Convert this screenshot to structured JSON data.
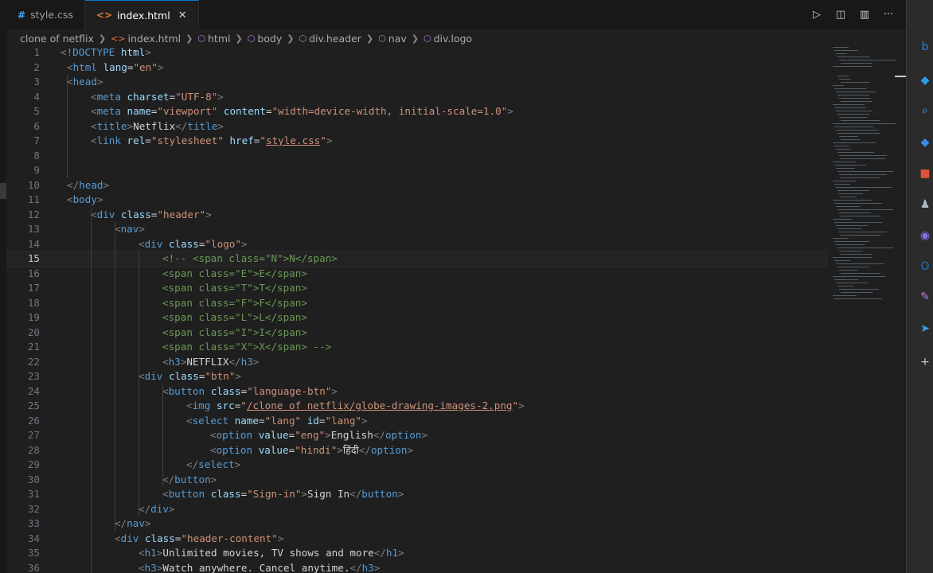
{
  "tabs": [
    {
      "label": "style.css",
      "icon": "css-file-icon",
      "active": false
    },
    {
      "label": "index.html",
      "icon": "html-file-icon",
      "active": true
    }
  ],
  "tab_actions": [
    "run-icon",
    "compare-icon",
    "split-editor-icon",
    "more-icon"
  ],
  "breadcrumb": [
    {
      "label": "clone of netflix",
      "icon": ""
    },
    {
      "label": "index.html",
      "icon": "html-file-icon"
    },
    {
      "label": "html",
      "icon": "cube-icon"
    },
    {
      "label": "body",
      "icon": "cube-icon"
    },
    {
      "label": "div.header",
      "icon": "cube-icon"
    },
    {
      "label": "nav",
      "icon": "cube-icon"
    },
    {
      "label": "div.logo",
      "icon": "cube-icon"
    }
  ],
  "current_line": 15,
  "lines": [
    {
      "n": "1",
      "indent": 0,
      "tokens": [
        [
          "punc",
          "<!"
        ],
        [
          "tag",
          "DOCTYPE"
        ],
        [
          "text",
          " "
        ],
        [
          "attr",
          "html"
        ],
        [
          "punc",
          ">"
        ]
      ]
    },
    {
      "n": "2",
      "indent": 1,
      "tokens": [
        [
          "punc",
          "<"
        ],
        [
          "tag",
          "html"
        ],
        [
          "text",
          " "
        ],
        [
          "attr",
          "lang"
        ],
        [
          "text",
          "="
        ],
        [
          "str",
          "\"en\""
        ],
        [
          "punc",
          ">"
        ]
      ]
    },
    {
      "n": "3",
      "indent": 1,
      "tokens": [
        [
          "punc",
          "<"
        ],
        [
          "tag",
          "head"
        ],
        [
          "punc",
          ">"
        ]
      ]
    },
    {
      "n": "4",
      "indent": 2,
      "tokens": [
        [
          "punc",
          "<"
        ],
        [
          "tag",
          "meta"
        ],
        [
          "text",
          " "
        ],
        [
          "attr",
          "charset"
        ],
        [
          "text",
          "="
        ],
        [
          "str",
          "\"UTF-8\""
        ],
        [
          "punc",
          ">"
        ]
      ]
    },
    {
      "n": "5",
      "indent": 2,
      "tokens": [
        [
          "punc",
          "<"
        ],
        [
          "tag",
          "meta"
        ],
        [
          "text",
          " "
        ],
        [
          "attr",
          "name"
        ],
        [
          "text",
          "="
        ],
        [
          "str",
          "\"viewport\""
        ],
        [
          "text",
          " "
        ],
        [
          "attr",
          "content"
        ],
        [
          "text",
          "="
        ],
        [
          "str",
          "\"width=device-width, initial-scale=1.0\""
        ],
        [
          "punc",
          ">"
        ]
      ]
    },
    {
      "n": "6",
      "indent": 2,
      "tokens": [
        [
          "punc",
          "<"
        ],
        [
          "tag",
          "title"
        ],
        [
          "punc",
          ">"
        ],
        [
          "text",
          "Netflix"
        ],
        [
          "punc",
          "</"
        ],
        [
          "tag",
          "title"
        ],
        [
          "punc",
          ">"
        ]
      ]
    },
    {
      "n": "7",
      "indent": 2,
      "tokens": [
        [
          "punc",
          "<"
        ],
        [
          "tag",
          "link"
        ],
        [
          "text",
          " "
        ],
        [
          "attr",
          "rel"
        ],
        [
          "text",
          "="
        ],
        [
          "str",
          "\"stylesheet\""
        ],
        [
          "text",
          " "
        ],
        [
          "attr",
          "href"
        ],
        [
          "text",
          "="
        ],
        [
          "str",
          "\""
        ],
        [
          "ul",
          "style.css"
        ],
        [
          "str",
          "\""
        ],
        [
          "punc",
          ">"
        ]
      ]
    },
    {
      "n": "8",
      "indent": 0,
      "tokens": []
    },
    {
      "n": "9",
      "indent": 0,
      "tokens": []
    },
    {
      "n": "10",
      "indent": 1,
      "tokens": [
        [
          "punc",
          "</"
        ],
        [
          "tag",
          "head"
        ],
        [
          "punc",
          ">"
        ]
      ]
    },
    {
      "n": "11",
      "indent": 1,
      "tokens": [
        [
          "punc",
          "<"
        ],
        [
          "tag",
          "body"
        ],
        [
          "punc",
          ">"
        ]
      ]
    },
    {
      "n": "12",
      "indent": 2,
      "tokens": [
        [
          "punc",
          "<"
        ],
        [
          "tag",
          "div"
        ],
        [
          "text",
          " "
        ],
        [
          "attr",
          "class"
        ],
        [
          "text",
          "="
        ],
        [
          "str",
          "\"header\""
        ],
        [
          "punc",
          ">"
        ]
      ]
    },
    {
      "n": "13",
      "indent": 3,
      "tokens": [
        [
          "punc",
          "<"
        ],
        [
          "tag",
          "nav"
        ],
        [
          "punc",
          ">"
        ]
      ]
    },
    {
      "n": "14",
      "indent": 4,
      "tokens": [
        [
          "punc",
          "<"
        ],
        [
          "tag",
          "div"
        ],
        [
          "text",
          " "
        ],
        [
          "attr",
          "class"
        ],
        [
          "text",
          "="
        ],
        [
          "str",
          "\"logo\""
        ],
        [
          "punc",
          ">"
        ]
      ]
    },
    {
      "n": "15",
      "indent": 5,
      "tokens": [
        [
          "com",
          "<!-- <span class=\"N\">N</span>"
        ]
      ]
    },
    {
      "n": "16",
      "indent": 5,
      "tokens": [
        [
          "com",
          "<span class=\"E\">E</span>"
        ]
      ]
    },
    {
      "n": "17",
      "indent": 5,
      "tokens": [
        [
          "com",
          "<span class=\"T\">T</span>"
        ]
      ]
    },
    {
      "n": "18",
      "indent": 5,
      "tokens": [
        [
          "com",
          "<span class=\"F\">F</span>"
        ]
      ]
    },
    {
      "n": "19",
      "indent": 5,
      "tokens": [
        [
          "com",
          "<span class=\"L\">L</span>"
        ]
      ]
    },
    {
      "n": "20",
      "indent": 5,
      "tokens": [
        [
          "com",
          "<span class=\"I\">I</span>"
        ]
      ]
    },
    {
      "n": "21",
      "indent": 5,
      "tokens": [
        [
          "com",
          "<span class=\"X\">X</span> -->"
        ]
      ]
    },
    {
      "n": "22",
      "indent": 5,
      "tokens": [
        [
          "punc",
          "<"
        ],
        [
          "tag",
          "h3"
        ],
        [
          "punc",
          ">"
        ],
        [
          "text",
          "NETFLIX"
        ],
        [
          "punc",
          "</"
        ],
        [
          "tag",
          "h3"
        ],
        [
          "punc",
          ">"
        ]
      ]
    },
    {
      "n": "23",
      "indent": 4,
      "tokens": [
        [
          "punc",
          "<"
        ],
        [
          "tag",
          "div"
        ],
        [
          "text",
          " "
        ],
        [
          "attr",
          "class"
        ],
        [
          "text",
          "="
        ],
        [
          "str",
          "\"btn\""
        ],
        [
          "punc",
          ">"
        ]
      ]
    },
    {
      "n": "24",
      "indent": 5,
      "tokens": [
        [
          "punc",
          "<"
        ],
        [
          "tag",
          "button"
        ],
        [
          "text",
          " "
        ],
        [
          "attr",
          "class"
        ],
        [
          "text",
          "="
        ],
        [
          "str",
          "\"language-btn\""
        ],
        [
          "punc",
          ">"
        ]
      ]
    },
    {
      "n": "25",
      "indent": 6,
      "tokens": [
        [
          "punc",
          "<"
        ],
        [
          "tag",
          "img"
        ],
        [
          "text",
          " "
        ],
        [
          "attr",
          "src"
        ],
        [
          "text",
          "="
        ],
        [
          "str",
          "\""
        ],
        [
          "ul",
          "/clone of netflix/globe-drawing-images-2.png"
        ],
        [
          "str",
          "\""
        ],
        [
          "punc",
          ">"
        ]
      ]
    },
    {
      "n": "26",
      "indent": 6,
      "tokens": [
        [
          "punc",
          "<"
        ],
        [
          "tag",
          "select"
        ],
        [
          "text",
          " "
        ],
        [
          "attr",
          "name"
        ],
        [
          "text",
          "="
        ],
        [
          "str",
          "\"lang\""
        ],
        [
          "text",
          " "
        ],
        [
          "attr",
          "id"
        ],
        [
          "text",
          "="
        ],
        [
          "str",
          "\"lang\""
        ],
        [
          "punc",
          ">"
        ]
      ]
    },
    {
      "n": "27",
      "indent": 7,
      "tokens": [
        [
          "punc",
          "<"
        ],
        [
          "tag",
          "option"
        ],
        [
          "text",
          " "
        ],
        [
          "attr",
          "value"
        ],
        [
          "text",
          "="
        ],
        [
          "str",
          "\"eng\""
        ],
        [
          "punc",
          ">"
        ],
        [
          "text",
          "English"
        ],
        [
          "punc",
          "</"
        ],
        [
          "tag",
          "option"
        ],
        [
          "punc",
          ">"
        ]
      ]
    },
    {
      "n": "28",
      "indent": 7,
      "tokens": [
        [
          "punc",
          "<"
        ],
        [
          "tag",
          "option"
        ],
        [
          "text",
          " "
        ],
        [
          "attr",
          "value"
        ],
        [
          "text",
          "="
        ],
        [
          "str",
          "\"hindi\""
        ],
        [
          "punc",
          ">"
        ],
        [
          "text",
          "हिंदी"
        ],
        [
          "punc",
          "</"
        ],
        [
          "tag",
          "option"
        ],
        [
          "punc",
          ">"
        ]
      ]
    },
    {
      "n": "29",
      "indent": 6,
      "tokens": [
        [
          "punc",
          "</"
        ],
        [
          "tag",
          "select"
        ],
        [
          "punc",
          ">"
        ]
      ]
    },
    {
      "n": "30",
      "indent": 5,
      "tokens": [
        [
          "punc",
          "</"
        ],
        [
          "tag",
          "button"
        ],
        [
          "punc",
          ">"
        ]
      ]
    },
    {
      "n": "31",
      "indent": 5,
      "tokens": [
        [
          "punc",
          "<"
        ],
        [
          "tag",
          "button"
        ],
        [
          "text",
          " "
        ],
        [
          "attr",
          "class"
        ],
        [
          "text",
          "="
        ],
        [
          "str",
          "\"Sign-in\""
        ],
        [
          "punc",
          ">"
        ],
        [
          "text",
          "Sign In"
        ],
        [
          "punc",
          "</"
        ],
        [
          "tag",
          "button"
        ],
        [
          "punc",
          ">"
        ]
      ]
    },
    {
      "n": "32",
      "indent": 4,
      "tokens": [
        [
          "punc",
          "</"
        ],
        [
          "tag",
          "div"
        ],
        [
          "punc",
          ">"
        ]
      ]
    },
    {
      "n": "33",
      "indent": 3,
      "tokens": [
        [
          "punc",
          "</"
        ],
        [
          "tag",
          "nav"
        ],
        [
          "punc",
          ">"
        ]
      ]
    },
    {
      "n": "34",
      "indent": 3,
      "tokens": [
        [
          "punc",
          "<"
        ],
        [
          "tag",
          "div"
        ],
        [
          "text",
          " "
        ],
        [
          "attr",
          "class"
        ],
        [
          "text",
          "="
        ],
        [
          "str",
          "\"header-content\""
        ],
        [
          "punc",
          ">"
        ]
      ]
    },
    {
      "n": "35",
      "indent": 4,
      "tokens": [
        [
          "punc",
          "<"
        ],
        [
          "tag",
          "h1"
        ],
        [
          "punc",
          ">"
        ],
        [
          "text",
          "Unlimited movies, TV shows and more"
        ],
        [
          "punc",
          "</"
        ],
        [
          "tag",
          "h1"
        ],
        [
          "punc",
          ">"
        ]
      ]
    },
    {
      "n": "36",
      "indent": 4,
      "tokens": [
        [
          "punc",
          "<"
        ],
        [
          "tag",
          "h3"
        ],
        [
          "punc",
          ">"
        ],
        [
          "text",
          "Watch anywhere. Cancel anytime."
        ],
        [
          "punc",
          "</"
        ],
        [
          "tag",
          "h3"
        ],
        [
          "punc",
          ">"
        ]
      ]
    }
  ],
  "right_bar_icons": [
    {
      "icon": "bing-icon",
      "color": "#2f7de1"
    },
    {
      "icon": "bell-icon",
      "color": "#2f9be8"
    },
    {
      "icon": "search-icon",
      "color": "#4aa3ff"
    },
    {
      "icon": "tag-icon",
      "color": "#3c8ce7"
    },
    {
      "icon": "toolbox-icon",
      "color": "#e0513a"
    },
    {
      "icon": "people-icon",
      "color": "#b0b8c4"
    },
    {
      "icon": "copilot-icon",
      "color": "#8a6ff0"
    },
    {
      "icon": "outlook-icon",
      "color": "#1a73c8"
    },
    {
      "icon": "designer-icon",
      "color": "#b57be8"
    },
    {
      "icon": "send-icon",
      "color": "#3aa0e8"
    },
    {
      "icon": "add-icon",
      "color": "#cccccc"
    }
  ],
  "colors": {
    "editor_bg": "#1f1f1f",
    "tag": "#569cd6",
    "attr": "#9cdcfe",
    "string": "#ce9178",
    "comment": "#6a9955",
    "active_tab_border": "#0078d4"
  }
}
